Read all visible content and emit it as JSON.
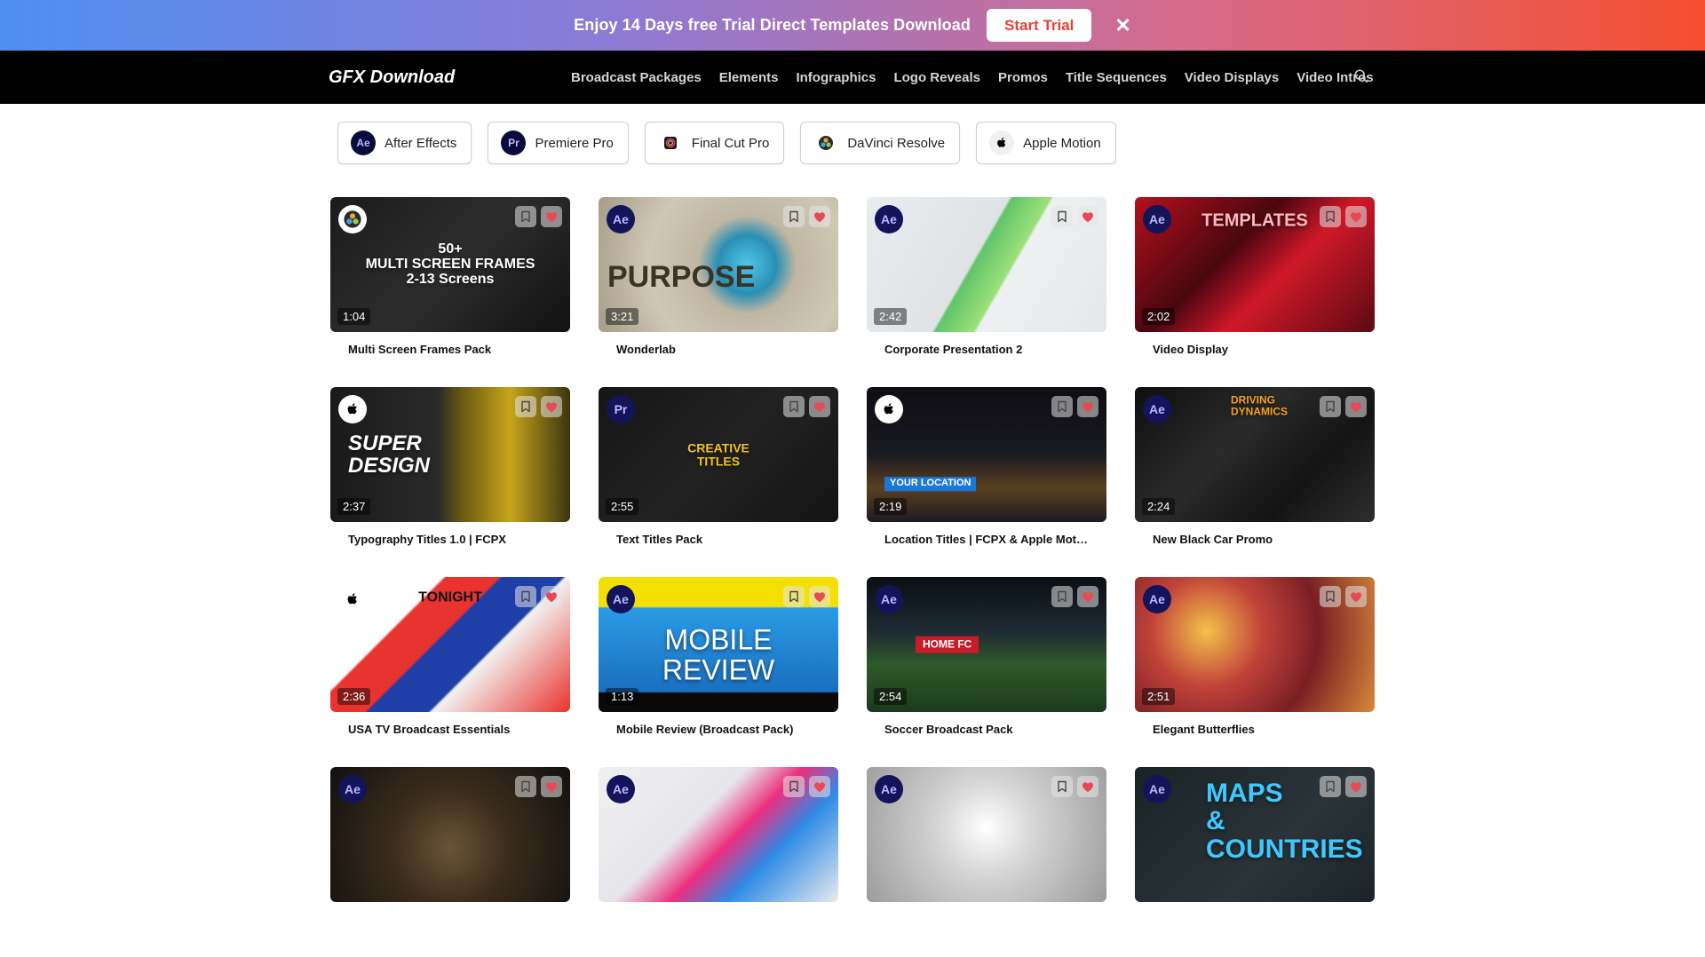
{
  "promo": {
    "text": "Enjoy 14 Days free Trial Direct Templates Download",
    "button_label": "Start Trial",
    "close_glyph": "✕"
  },
  "nav": {
    "brand": "GFX Download",
    "links": [
      "Broadcast Packages",
      "Elements",
      "Infographics",
      "Logo Reveals",
      "Promos",
      "Title Sequences",
      "Video Displays",
      "Video Intros"
    ],
    "search_icon": "search-icon"
  },
  "filters": [
    {
      "label": "After Effects",
      "icon": "Ae"
    },
    {
      "label": "Premiere Pro",
      "icon": "Pr"
    },
    {
      "label": "Final Cut Pro",
      "icon": "final-cut-icon"
    },
    {
      "label": "DaVinci Resolve",
      "icon": "davinci-icon"
    },
    {
      "label": "Apple Motion",
      "icon": "apple-icon"
    }
  ],
  "cards": [
    {
      "title": "Multi Screen Frames Pack",
      "duration": "1:04",
      "app": "dv",
      "overlay": "50+\nMULTI SCREEN FRAMES\n2-13 Screens",
      "bg": "linear-gradient(135deg,#1b1b1b,#2d2d2d 50%,#121212)"
    },
    {
      "title": "Wonderlab",
      "duration": "3:21",
      "app": "Ae",
      "overlay": "PURPOSE",
      "bg": "radial-gradient(circle at 62% 50%,#4fc6e8 0,#2b8fb5 18%,#bfb7a2 30%,#cfc8b4 60%,#a69c88 100%)"
    },
    {
      "title": "Corporate Presentation 2",
      "duration": "2:42",
      "app": "Ae",
      "overlay": "",
      "bg": "linear-gradient(120deg,#e9ecef 0,#dfe3e6 45%,#62c46a 46%,#9be07a 58%,#eef1f2 59%,#e4e7ea 100%)"
    },
    {
      "title": "Video Display",
      "duration": "2:02",
      "app": "Ae",
      "overlay": "TEMPLATES",
      "bg": "linear-gradient(135deg,#b3101c 0,#4a0710 40%,#d01828 60%,#5c0a12 100%)"
    },
    {
      "title": "Typography Titles 1.0 | FCPX",
      "duration": "2:37",
      "app": "am",
      "overlay": "SUPER\nDESIGN",
      "bg": "linear-gradient(90deg,#1a1a1a 0,#2a2a2a 45%,#6b5a10 55%,#c8a41c 75%,#3b3510 100%)"
    },
    {
      "title": "Text Titles Pack",
      "duration": "2:55",
      "app": "Pr",
      "overlay": "CREATIVE\nTITLES",
      "bg": "linear-gradient(135deg,#161616,#222 50%,#141414)"
    },
    {
      "title": "Location Titles | FCPX & Apple Motion",
      "duration": "2:19",
      "app": "am",
      "overlay": "YOUR LOCATION",
      "bg": "linear-gradient(180deg,#0d0d12 0,#1a1a22 50%,#5a4020 75%,#1b1b22 100%)"
    },
    {
      "title": "New Black Car Promo",
      "duration": "2:24",
      "app": "Ae",
      "overlay": "DRIVING\nDYNAMICS",
      "bg": "linear-gradient(135deg,#0e0e0e,#2a2a2a 40%,#141414 70%,#2e2e2e)"
    },
    {
      "title": "USA TV Broadcast Essentials",
      "duration": "2:36",
      "app": "am",
      "overlay": "TONIGHT",
      "bg": "linear-gradient(135deg,#ffffff 0,#ffffff 30%,#e8332e 31%,#e8332e 45%,#1e3fa8 46%,#1e3fa8 62%,#f2f2f2 63%,#e8332e 100%)"
    },
    {
      "title": "Mobile Review (Broadcast Pack)",
      "duration": "1:13",
      "app": "Ae",
      "overlay": "MOBILE\nREVIEW",
      "bg": "linear-gradient(180deg,#f4e000 0,#f4e000 22%,#2a9be6 23%,#1a6fbf 85%,#0a0a0a 86%)"
    },
    {
      "title": "Soccer Broadcast Pack",
      "duration": "2:54",
      "app": "Ae",
      "overlay": "HOME FC",
      "bg": "linear-gradient(180deg,#0a0f12 0,#1e2a33 40%,#2f5a2a 65%,#1d3a1c 100%)"
    },
    {
      "title": "Elegant Butterflies",
      "duration": "2:51",
      "app": "Ae",
      "overlay": "",
      "bg": "radial-gradient(circle at 30% 40%,#f3c24a 0,#c2423a 30%,#7a1f24 60%,#d98a3a 100%)"
    },
    {
      "title": "",
      "duration": "",
      "app": "Ae",
      "overlay": "",
      "bg": "radial-gradient(circle at 50% 60%,#6b5436 0,#3a2d1c 40%,#121010 100%)"
    },
    {
      "title": "",
      "duration": "",
      "app": "Ae",
      "overlay": "",
      "bg": "linear-gradient(135deg,#f0f0f2 0,#e6e6ea 40%,#ec2f7e 55%,#2e8be6 70%,#eaeaee 100%)"
    },
    {
      "title": "",
      "duration": "",
      "app": "Ae",
      "overlay": "",
      "bg": "radial-gradient(circle at 50% 45%,#ffffff 0,#d4d4d4 35%,#9b9b9b 100%)"
    },
    {
      "title": "",
      "duration": "",
      "app": "Ae",
      "overlay": "MAPS\n& COUNTRIES",
      "bg": "linear-gradient(135deg,#1a2226,#2b3438 60%,#1b2327)"
    }
  ],
  "colors": {
    "accent": "#e8413a",
    "fav": "#e84a55",
    "nav_bg": "#000000"
  }
}
